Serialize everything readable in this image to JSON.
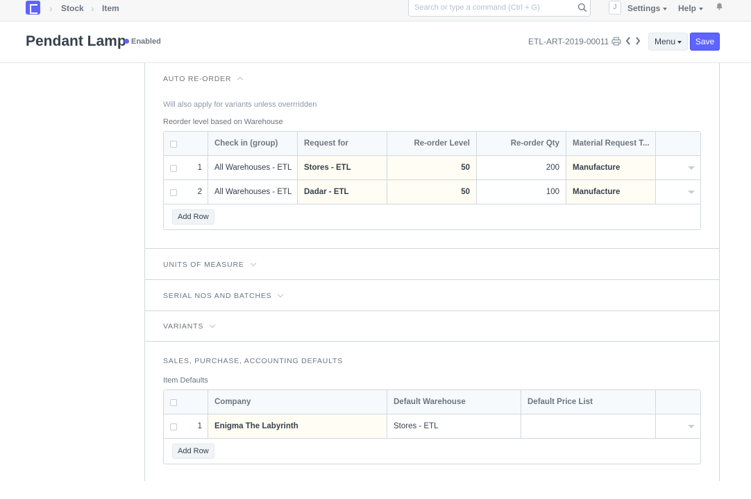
{
  "navbar": {
    "breadcrumbs": [
      "Stock",
      "Item"
    ],
    "search_placeholder": "Search or type a command (Ctrl + G)",
    "avatar_letter": "J",
    "settings_label": "Settings",
    "help_label": "Help"
  },
  "header": {
    "title": "Pendant Lamp",
    "status": "Enabled",
    "status_color": "#5e64ff",
    "doc_name": "ETL-ART-2019-00011",
    "menu_label": "Menu",
    "save_label": "Save"
  },
  "auto_reorder": {
    "title": "AUTO RE-ORDER",
    "help": "Will also apply for variants unless overrridden",
    "table_label": "Reorder level based on Warehouse",
    "columns": [
      "Check in (group)",
      "Request for",
      "Re-order Level",
      "Re-order Qty",
      "Material Request T..."
    ],
    "rows": [
      {
        "idx": "1",
        "check_in": "All Warehouses - ETL",
        "request_for": "Stores - ETL",
        "level": "50",
        "qty": "200",
        "type": "Manufacture"
      },
      {
        "idx": "2",
        "check_in": "All Warehouses - ETL",
        "request_for": "Dadar - ETL",
        "level": "50",
        "qty": "100",
        "type": "Manufacture"
      }
    ],
    "add_row": "Add Row"
  },
  "sections": {
    "uom": "UNITS OF MEASURE",
    "serial": "SERIAL NOS AND BATCHES",
    "variants": "VARIANTS",
    "defaults": "SALES, PURCHASE, ACCOUNTING DEFAULTS"
  },
  "item_defaults": {
    "table_label": "Item Defaults",
    "columns": [
      "Company",
      "Default Warehouse",
      "Default Price List"
    ],
    "rows": [
      {
        "idx": "1",
        "company": "Enigma The Labyrinth",
        "warehouse": "Stores - ETL",
        "price_list": ""
      }
    ],
    "add_row": "Add Row"
  },
  "colors": {
    "accent": "#5e64ff",
    "editable_cell": "#fffdf4"
  }
}
